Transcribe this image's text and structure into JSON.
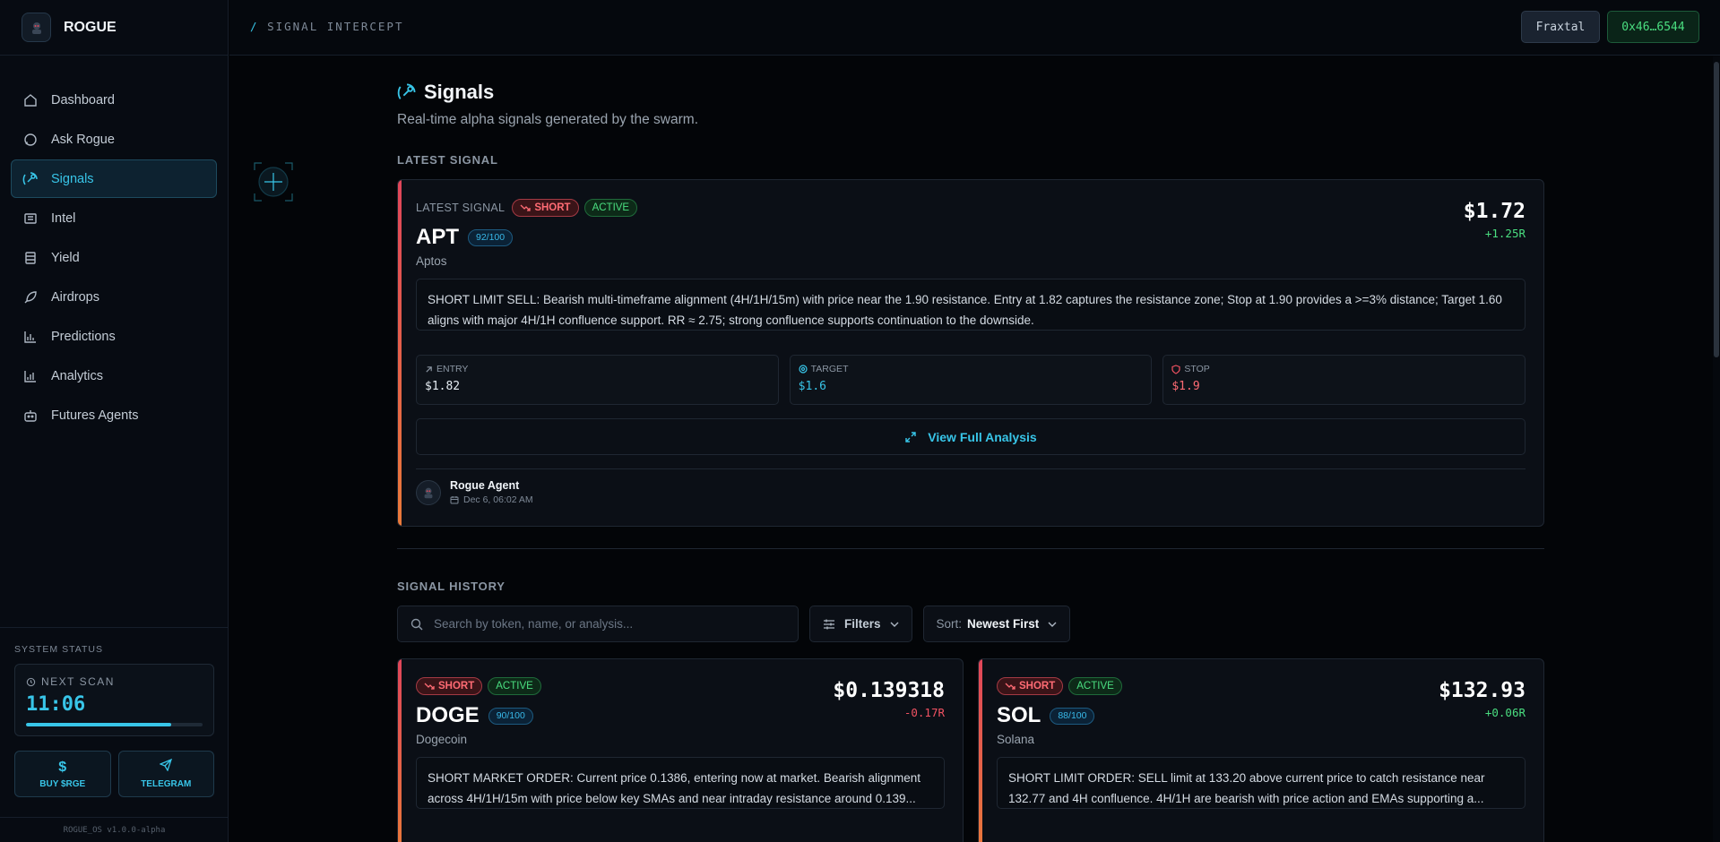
{
  "app": {
    "name": "ROGUE",
    "version": "ROGUE_OS v1.0.0-alpha"
  },
  "sidebar": {
    "items": [
      {
        "label": "Dashboard",
        "icon": "home-icon"
      },
      {
        "label": "Ask Rogue",
        "icon": "chat-icon"
      },
      {
        "label": "Signals",
        "icon": "satellite-icon",
        "active": true
      },
      {
        "label": "Intel",
        "icon": "newspaper-icon"
      },
      {
        "label": "Yield",
        "icon": "coins-icon"
      },
      {
        "label": "Airdrops",
        "icon": "rocket-icon"
      },
      {
        "label": "Predictions",
        "icon": "bar-chart-icon"
      },
      {
        "label": "Analytics",
        "icon": "analytics-icon"
      },
      {
        "label": "Futures Agents",
        "icon": "bot-icon"
      }
    ],
    "status": {
      "title": "SYSTEM STATUS",
      "next_scan_label": "NEXT SCAN",
      "next_scan_time": "11:06",
      "progress": 0.82
    },
    "buttons": {
      "buy": "BUY $RGE",
      "telegram": "TELEGRAM"
    }
  },
  "header": {
    "breadcrumb_slash": "/",
    "breadcrumb": "SIGNAL INTERCEPT",
    "wallet_name": "Fraxtal",
    "wallet_address": "0x46…6544"
  },
  "page": {
    "title": "Signals",
    "subtitle": "Real-time alpha signals generated by the swarm."
  },
  "latest": {
    "section_label": "LATEST SIGNAL",
    "inline_label": "LATEST SIGNAL",
    "direction": "SHORT",
    "status": "ACTIVE",
    "ticker": "APT",
    "score": "92/100",
    "name": "Aptos",
    "price": "$1.72",
    "r": "+1.25R",
    "analysis": "SHORT LIMIT SELL: Bearish multi-timeframe alignment (4H/1H/15m) with price near the 1.90 resistance. Entry at 1.82 captures the resistance zone; Stop at 1.90 provides a >=3% distance; Target 1.60 aligns with major 4H/1H confluence support. RR ≈ 2.75; strong confluence supports continuation to the downside.",
    "entry_label": "ENTRY",
    "entry": "$1.82",
    "target_label": "TARGET",
    "target": "$1.6",
    "stop_label": "STOP",
    "stop": "$1.9",
    "view_label": "View Full Analysis",
    "agent": "Rogue Agent",
    "timestamp": "Dec 6, 06:02 AM"
  },
  "history": {
    "section_label": "SIGNAL HISTORY",
    "search_placeholder": "Search by token, name, or analysis...",
    "filters_label": "Filters",
    "sort_label": "Sort:",
    "sort_value": "Newest First",
    "cards": [
      {
        "direction": "SHORT",
        "status": "ACTIVE",
        "ticker": "DOGE",
        "score": "90/100",
        "name": "Dogecoin",
        "price": "$0.139318",
        "r": "-0.17R",
        "analysis": "SHORT MARKET ORDER: Current price 0.1386, entering now at market. Bearish alignment across 4H/1H/15m with price below key SMAs and near intraday resistance around 0.139..."
      },
      {
        "direction": "SHORT",
        "status": "ACTIVE",
        "ticker": "SOL",
        "score": "88/100",
        "name": "Solana",
        "price": "$132.93",
        "r": "+0.06R",
        "analysis": "SHORT LIMIT ORDER: SELL limit at 133.20 above current price to catch resistance near 132.77 and 4H confluence. 4H/1H are bearish with price action and EMAs supporting a..."
      }
    ]
  },
  "colors": {
    "accent": "#38c5e8",
    "short": "#ff6b74",
    "positive": "#4ade80",
    "background": "#030508"
  }
}
